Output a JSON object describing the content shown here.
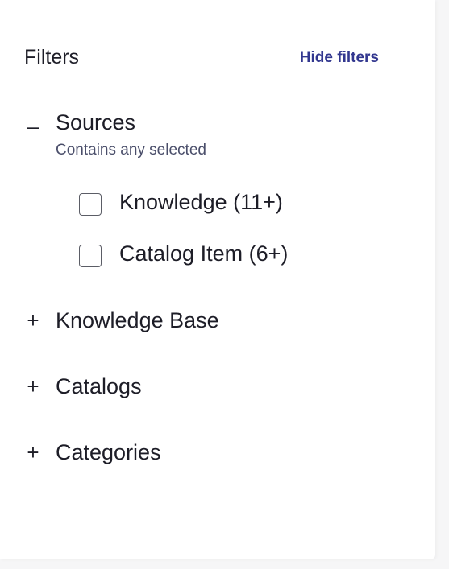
{
  "filters": {
    "title": "Filters",
    "hide_label": "Hide filters"
  },
  "sections": [
    {
      "toggle": "_",
      "label": "Sources",
      "subtitle": "Contains any selected",
      "options": [
        {
          "label": "Knowledge (11+)",
          "checked": false
        },
        {
          "label": "Catalog Item (6+)",
          "checked": false
        }
      ]
    },
    {
      "toggle": "+",
      "label": "Knowledge Base"
    },
    {
      "toggle": "+",
      "label": "Catalogs"
    },
    {
      "toggle": "+",
      "label": "Categories"
    }
  ],
  "colors": {
    "link": "#32378f",
    "text": "#1d1d27",
    "subtext": "#4a4e6a"
  }
}
